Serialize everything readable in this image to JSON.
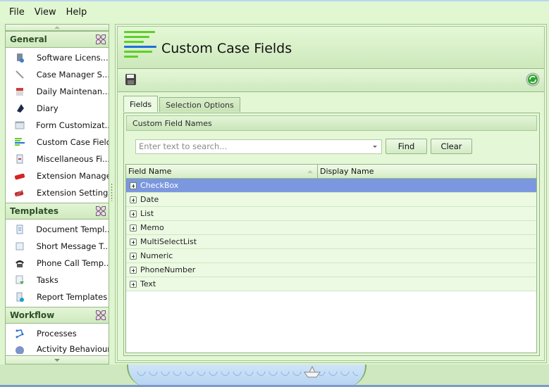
{
  "menu": [
    "File",
    "View",
    "Help"
  ],
  "sidebar": {
    "groups": [
      {
        "title": "General",
        "items": [
          {
            "label": "Software Licens...",
            "icon": "server-icon"
          },
          {
            "label": "Case Manager S...",
            "icon": "wrench-icon"
          },
          {
            "label": "Daily Maintenan...",
            "icon": "calendar-icon"
          },
          {
            "label": "Diary",
            "icon": "diary-icon"
          },
          {
            "label": "Form Customizat...",
            "icon": "form-icon"
          },
          {
            "label": "Custom Case Fields",
            "icon": "fields-icon"
          },
          {
            "label": "Miscellaneous Fi...",
            "icon": "document-icon"
          },
          {
            "label": "Extension Manager",
            "icon": "extension-icon"
          },
          {
            "label": "Extension Settings",
            "icon": "extension-settings-icon"
          }
        ]
      },
      {
        "title": "Templates",
        "items": [
          {
            "label": "Document Templ...",
            "icon": "document-template-icon"
          },
          {
            "label": "Short Message T...",
            "icon": "sms-icon"
          },
          {
            "label": "Phone Call Temp...",
            "icon": "phone-icon"
          },
          {
            "label": "Tasks",
            "icon": "tasks-icon"
          },
          {
            "label": "Report Templates",
            "icon": "report-icon"
          }
        ]
      },
      {
        "title": "Workflow",
        "items": [
          {
            "label": "Processes",
            "icon": "process-icon"
          },
          {
            "label": "Activity Behaviour...",
            "icon": "activity-icon"
          }
        ]
      }
    ]
  },
  "main": {
    "title": "Custom Case Fields",
    "tabs": [
      "Fields",
      "Selection Options"
    ],
    "active_tab": "Fields",
    "section_title": "Custom Field Names",
    "search": {
      "placeholder": "Enter text to search...",
      "value": ""
    },
    "find_label": "Find",
    "clear_label": "Clear",
    "columns": [
      "Field Name",
      "Display Name"
    ],
    "rows": [
      "CheckBox",
      "Date",
      "List",
      "Memo",
      "MultiSelectList",
      "Numeric",
      "PhoneNumber",
      "Text"
    ],
    "selected_row": "CheckBox"
  },
  "colors": {
    "selection": "#7b97df",
    "panel": "#e3f7d5",
    "accent_green": "#5fcf2a",
    "accent_blue": "#1f6fd9"
  }
}
